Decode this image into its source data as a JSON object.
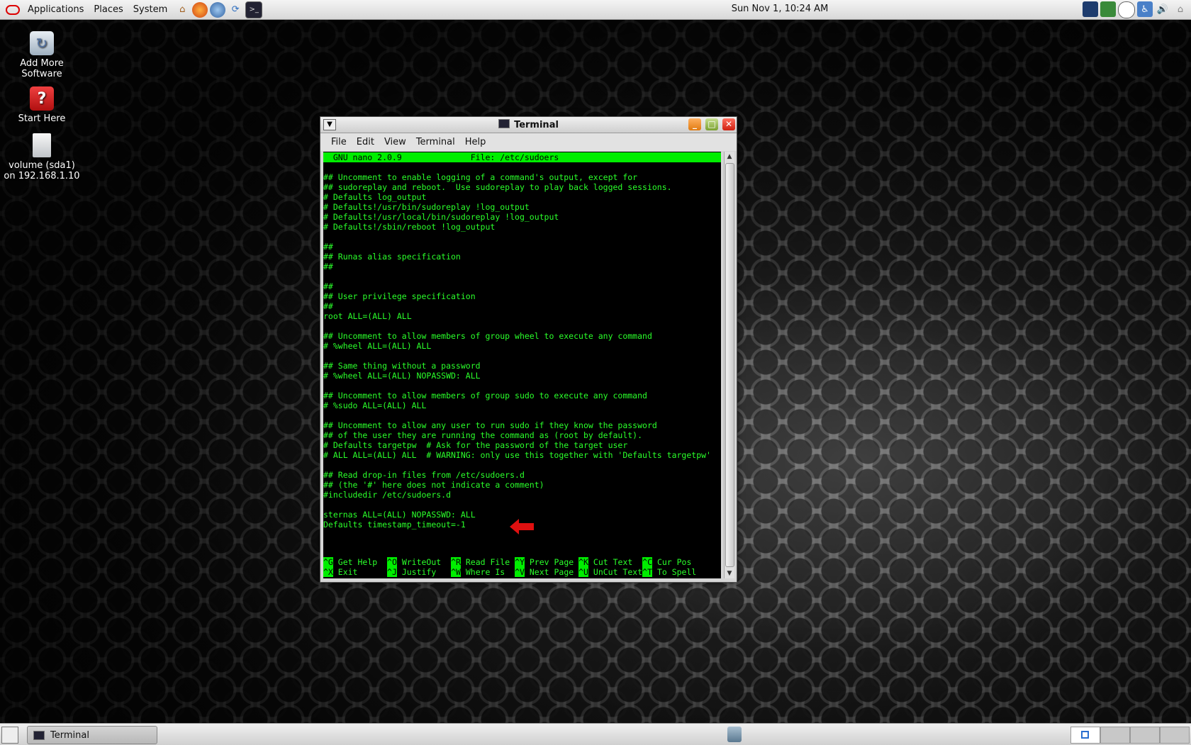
{
  "top_panel": {
    "menus": [
      "Applications",
      "Places",
      "System"
    ],
    "clock": "Sun Nov  1, 10:24 AM",
    "launchers": [
      "home-icon",
      "firefox-icon",
      "thunderbird-icon",
      "update-icon",
      "terminal-icon"
    ],
    "tray": [
      "system-monitor-icon",
      "network-icon",
      "clock-applet-icon",
      "accessibility-icon",
      "volume-icon",
      "lock-icon"
    ]
  },
  "desktop": {
    "icons": [
      {
        "label": "Add More Software",
        "icon": "software-icon"
      },
      {
        "label": "Start Here",
        "icon": "help-icon"
      },
      {
        "label": "volume (sda1) on 192.168.1.10",
        "icon": "volume-icon"
      }
    ]
  },
  "window": {
    "title": "Terminal",
    "menus": [
      "File",
      "Edit",
      "View",
      "Terminal",
      "Help"
    ],
    "nano_header": "  GNU nano 2.0.9              File: /etc/sudoers",
    "lines": [
      "## Uncomment to enable logging of a command's output, except for",
      "## sudoreplay and reboot.  Use sudoreplay to play back logged sessions.",
      "# Defaults log_output",
      "# Defaults!/usr/bin/sudoreplay !log_output",
      "# Defaults!/usr/local/bin/sudoreplay !log_output",
      "# Defaults!/sbin/reboot !log_output",
      "",
      "##",
      "## Runas alias specification",
      "##",
      "",
      "##",
      "## User privilege specification",
      "##",
      "root ALL=(ALL) ALL",
      "",
      "## Uncomment to allow members of group wheel to execute any command",
      "# %wheel ALL=(ALL) ALL",
      "",
      "## Same thing without a password",
      "# %wheel ALL=(ALL) NOPASSWD: ALL",
      "",
      "## Uncomment to allow members of group sudo to execute any command",
      "# %sudo ALL=(ALL) ALL",
      "",
      "## Uncomment to allow any user to run sudo if they know the password",
      "## of the user they are running the command as (root by default).",
      "# Defaults targetpw  # Ask for the password of the target user",
      "# ALL ALL=(ALL) ALL  # WARNING: only use this together with 'Defaults targetpw'",
      "",
      "## Read drop-in files from /etc/sudoers.d",
      "## (the '#' here does not indicate a comment)",
      "#includedir /etc/sudoers.d",
      "",
      "sternas ALL=(ALL) NOPASSWD: ALL",
      "Defaults timestamp_timeout=-1"
    ],
    "shortcuts_row1": [
      {
        "key": "^G",
        "label": "Get Help"
      },
      {
        "key": "^O",
        "label": "WriteOut"
      },
      {
        "key": "^R",
        "label": "Read File"
      },
      {
        "key": "^Y",
        "label": "Prev Page"
      },
      {
        "key": "^K",
        "label": "Cut Text"
      },
      {
        "key": "^C",
        "label": "Cur Pos"
      }
    ],
    "shortcuts_row2": [
      {
        "key": "^X",
        "label": "Exit"
      },
      {
        "key": "^J",
        "label": "Justify"
      },
      {
        "key": "^W",
        "label": "Where Is"
      },
      {
        "key": "^V",
        "label": "Next Page"
      },
      {
        "key": "^U",
        "label": "UnCut Text"
      },
      {
        "key": "^T",
        "label": "To Spell"
      }
    ],
    "annotation": "red-arrow-icon"
  },
  "bottom_panel": {
    "task": "Terminal",
    "workspaces": 4
  },
  "colors": {
    "terminal_fg": "#2aff2a",
    "nano_bar": "#00ee00",
    "arrow": "#e01010"
  }
}
